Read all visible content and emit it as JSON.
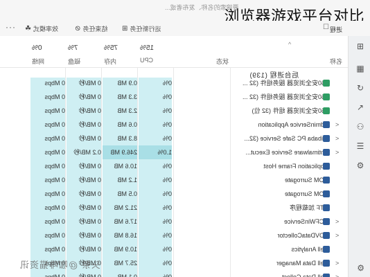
{
  "search_hint": "要搜索的名称、发布者或...",
  "overlay_title": "浏览器游戏平台对比",
  "toolbar": {
    "more": "···",
    "efficiency": "效率模式",
    "end_task": "结束任务",
    "new_task": "运行新任务",
    "process_label": "进程",
    "mark": "☐"
  },
  "columns": {
    "net": {
      "pct": "0%",
      "name": "网络"
    },
    "disk": {
      "pct": "7%",
      "name": "磁盘"
    },
    "mem": {
      "pct": "75%",
      "name": "内存"
    },
    "cpu": {
      "pct": "15%",
      "name": "CPU"
    },
    "status": "状态",
    "name": "名称",
    "sort_arrow": "^"
  },
  "group_title": "后台进程 (139)",
  "rows": [
    {
      "name": "360安全浏览器 服务组件 (32 ...",
      "cpu": "0%",
      "mem": "0.9 MB",
      "disk": "0 MB/秒",
      "net": "0 Mbps",
      "icon": "green",
      "chev": ""
    },
    {
      "name": "360安全浏览器 服务组件 (32 ...",
      "cpu": "0%",
      "mem": "3.3 MB",
      "disk": "0 MB/秒",
      "net": "0 Mbps",
      "icon": "green",
      "chev": ""
    },
    {
      "name": "360安全浏览器 组件 (32 位)",
      "cpu": "0%",
      "mem": "2.3 MB",
      "disk": "0 MB/秒",
      "net": "0 Mbps",
      "icon": "green",
      "chev": ""
    },
    {
      "name": "AdminService Application",
      "cpu": "0%",
      "mem": "0.6 MB",
      "disk": "0 MB/秒",
      "net": "0 Mbps",
      "icon": "blue",
      "chev": ">"
    },
    {
      "name": "Alibaba PC Safe Service (32...",
      "cpu": "0%",
      "mem": "8.3 MB",
      "disk": "0 MB/秒",
      "net": "0 Mbps",
      "icon": "blue",
      "chev": ">"
    },
    {
      "name": "Antimalware Service Execut...",
      "cpu": "1.0%",
      "mem": "246.9 MB",
      "disk": "0.2 MB/秒",
      "net": "0 Mbps",
      "icon": "blue",
      "chev": ">",
      "highlight": true
    },
    {
      "name": "Application Frame Host",
      "cpu": "0%",
      "mem": "10.6 MB",
      "disk": "0 MB/秒",
      "net": "0 Mbps",
      "icon": "blue",
      "chev": ""
    },
    {
      "name": "COM Surrogate",
      "cpu": "0%",
      "mem": "1.2 MB",
      "disk": "0 MB/秒",
      "net": "0 Mbps",
      "icon": "blue",
      "chev": ""
    },
    {
      "name": "COM Surrogate",
      "cpu": "0%",
      "mem": "0.5 MB",
      "disk": "0 MB/秒",
      "net": "0 Mbps",
      "icon": "blue",
      "chev": ""
    },
    {
      "name": "CTF 加载程序",
      "cpu": "0%",
      "mem": "21.2 MB",
      "disk": "0 MB/秒",
      "net": "0 Mbps",
      "icon": "blue",
      "chev": ""
    },
    {
      "name": "DCFWinService",
      "cpu": "0%",
      "mem": "17.6 MB",
      "disk": "0 MB/秒",
      "net": "0 Mbps",
      "icon": "blue",
      "chev": ">"
    },
    {
      "name": "DDVDataCollector",
      "cpu": "0%",
      "mem": "16.8 MB",
      "disk": "0 MB/秒",
      "net": "0 Mbps",
      "icon": "blue",
      "chev": ">"
    },
    {
      "name": "Dell Analytics",
      "cpu": "0%",
      "mem": "10.9 MB",
      "disk": "0 MB/秒",
      "net": "0 Mbps",
      "icon": "blue",
      "chev": ""
    },
    {
      "name": "Dell Data Manager",
      "cpu": "0%",
      "mem": "25.7 MB",
      "disk": "0 MB/秒",
      "net": "0 Mbps",
      "icon": "blue",
      "chev": ">"
    },
    {
      "name": "Dell Data Collect...",
      "cpu": "0%",
      "mem": "0.1 MB",
      "disk": "0 MB/秒",
      "net": "0 Mbps",
      "icon": "blue",
      "chev": ">"
    }
  ],
  "watermark": "头条 @咖啡猫资讯"
}
